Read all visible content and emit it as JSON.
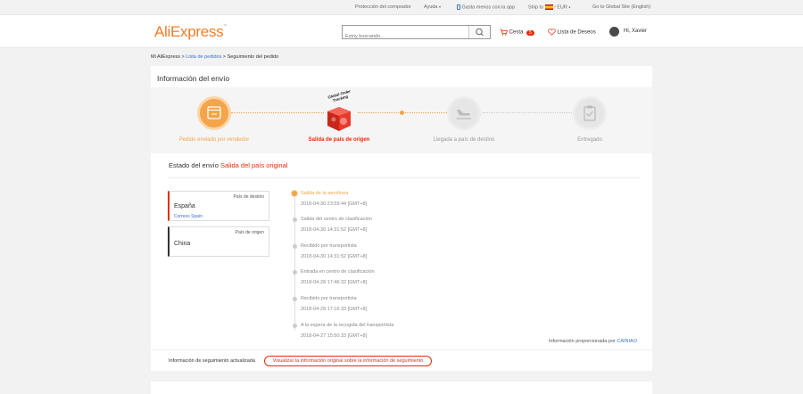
{
  "topbar": {
    "protection": "Protección del comprador",
    "help": "Ayuda",
    "app": "Gasta menos con la app",
    "ship_to": "Ship to",
    "currency": "EUR",
    "global": "Go to Global Site (English)"
  },
  "header": {
    "logo": "AliExpress",
    "search_placeholder": "Estoy buscando...",
    "cart_label": "Cesta",
    "cart_count": "5",
    "wishlist_label": "Lista de Deseos",
    "user_greeting": "Hi, Xavier"
  },
  "breadcrumb": {
    "home": "Mi AliExpress",
    "orders": "Lista de pedidos",
    "current": "Seguimiento del pedido"
  },
  "shipping": {
    "title": "Información del envío",
    "badge_text": "Global Order Tracking",
    "steps": [
      {
        "label": "Pedido enviado por vendedor"
      },
      {
        "label": "Salida de país de origen"
      },
      {
        "label": "Llegada a país de destino"
      },
      {
        "label": "Entregado"
      }
    ],
    "status_label": "Estado del envío",
    "status_value": "Salida del país original",
    "destination": {
      "label": "País de destino",
      "country": "España",
      "carrier": "Correos Spain"
    },
    "origin": {
      "label": "País de origen",
      "country": "China"
    },
    "events": [
      {
        "event": "Salida de la aerolínea",
        "time": "2018-04-30 23:59:44 [GMT+8]"
      },
      {
        "event": "Salida del centro de clasificación",
        "time": "2018-04-30 14:31:52 [GMT+8]"
      },
      {
        "event": "Recibido por transportista",
        "time": "2018-04-30 14:31:52 [GMT+8]"
      },
      {
        "event": "Entrada en centro de clasificación",
        "time": "2018-04-28 17:46:32 [GMT+8]"
      },
      {
        "event": "Recibido por transportista",
        "time": "2018-04-28 17:16:33 [GMT+8]"
      },
      {
        "event": "A la espera de la recogida del transportista",
        "time": "2018-04-27 15:50:33 [GMT+8]"
      }
    ],
    "provided_by": "Información proporcionada por",
    "provider": "CAINIAO",
    "updated_text": "Información de seguimiento actualizada",
    "original_button": "Visualizar la información original sobre la información de seguimiento"
  },
  "colors": {
    "accent": "#f47c28",
    "red": "#e62e04",
    "link": "#3b73c2"
  }
}
